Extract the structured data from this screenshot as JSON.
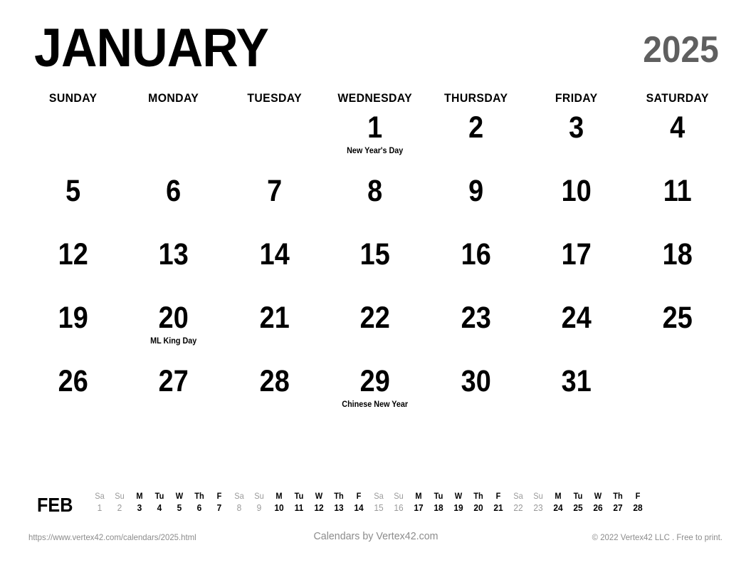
{
  "header": {
    "month": "JANUARY",
    "year": "2025",
    "year_color": "#5f5f5f"
  },
  "weekdays": [
    "SUNDAY",
    "MONDAY",
    "TUESDAY",
    "WEDNESDAY",
    "THURSDAY",
    "FRIDAY",
    "SATURDAY"
  ],
  "weeks": [
    [
      {
        "num": ""
      },
      {
        "num": ""
      },
      {
        "num": ""
      },
      {
        "num": "1",
        "event": "New Year's Day"
      },
      {
        "num": "2"
      },
      {
        "num": "3"
      },
      {
        "num": "4"
      }
    ],
    [
      {
        "num": "5"
      },
      {
        "num": "6"
      },
      {
        "num": "7"
      },
      {
        "num": "8"
      },
      {
        "num": "9"
      },
      {
        "num": "10"
      },
      {
        "num": "11"
      }
    ],
    [
      {
        "num": "12"
      },
      {
        "num": "13"
      },
      {
        "num": "14"
      },
      {
        "num": "15"
      },
      {
        "num": "16"
      },
      {
        "num": "17"
      },
      {
        "num": "18"
      }
    ],
    [
      {
        "num": "19"
      },
      {
        "num": "20",
        "event": "ML King Day"
      },
      {
        "num": "21"
      },
      {
        "num": "22"
      },
      {
        "num": "23"
      },
      {
        "num": "24"
      },
      {
        "num": "25"
      }
    ],
    [
      {
        "num": "26"
      },
      {
        "num": "27"
      },
      {
        "num": "28"
      },
      {
        "num": "29",
        "event": "Chinese New Year"
      },
      {
        "num": "30"
      },
      {
        "num": "31"
      },
      {
        "num": ""
      }
    ]
  ],
  "next_month_strip": {
    "label": "FEB",
    "weekend_color": "#9a9a9a",
    "days": [
      {
        "dow": "Sa",
        "num": "1",
        "weekend": true
      },
      {
        "dow": "Su",
        "num": "2",
        "weekend": true
      },
      {
        "dow": "M",
        "num": "3",
        "weekend": false
      },
      {
        "dow": "Tu",
        "num": "4",
        "weekend": false
      },
      {
        "dow": "W",
        "num": "5",
        "weekend": false
      },
      {
        "dow": "Th",
        "num": "6",
        "weekend": false
      },
      {
        "dow": "F",
        "num": "7",
        "weekend": false
      },
      {
        "dow": "Sa",
        "num": "8",
        "weekend": true
      },
      {
        "dow": "Su",
        "num": "9",
        "weekend": true
      },
      {
        "dow": "M",
        "num": "10",
        "weekend": false
      },
      {
        "dow": "Tu",
        "num": "11",
        "weekend": false
      },
      {
        "dow": "W",
        "num": "12",
        "weekend": false
      },
      {
        "dow": "Th",
        "num": "13",
        "weekend": false
      },
      {
        "dow": "F",
        "num": "14",
        "weekend": false
      },
      {
        "dow": "Sa",
        "num": "15",
        "weekend": true
      },
      {
        "dow": "Su",
        "num": "16",
        "weekend": true
      },
      {
        "dow": "M",
        "num": "17",
        "weekend": false
      },
      {
        "dow": "Tu",
        "num": "18",
        "weekend": false
      },
      {
        "dow": "W",
        "num": "19",
        "weekend": false
      },
      {
        "dow": "Th",
        "num": "20",
        "weekend": false
      },
      {
        "dow": "F",
        "num": "21",
        "weekend": false
      },
      {
        "dow": "Sa",
        "num": "22",
        "weekend": true
      },
      {
        "dow": "Su",
        "num": "23",
        "weekend": true
      },
      {
        "dow": "M",
        "num": "24",
        "weekend": false
      },
      {
        "dow": "Tu",
        "num": "25",
        "weekend": false
      },
      {
        "dow": "W",
        "num": "26",
        "weekend": false
      },
      {
        "dow": "Th",
        "num": "27",
        "weekend": false
      },
      {
        "dow": "F",
        "num": "28",
        "weekend": false
      }
    ]
  },
  "footer": {
    "url": "https://www.vertex42.com/calendars/2025.html",
    "center": "Calendars by Vertex42.com",
    "copyright": "© 2022 Vertex42 LLC . Free to print.",
    "text_color": "#8c8c8c"
  }
}
